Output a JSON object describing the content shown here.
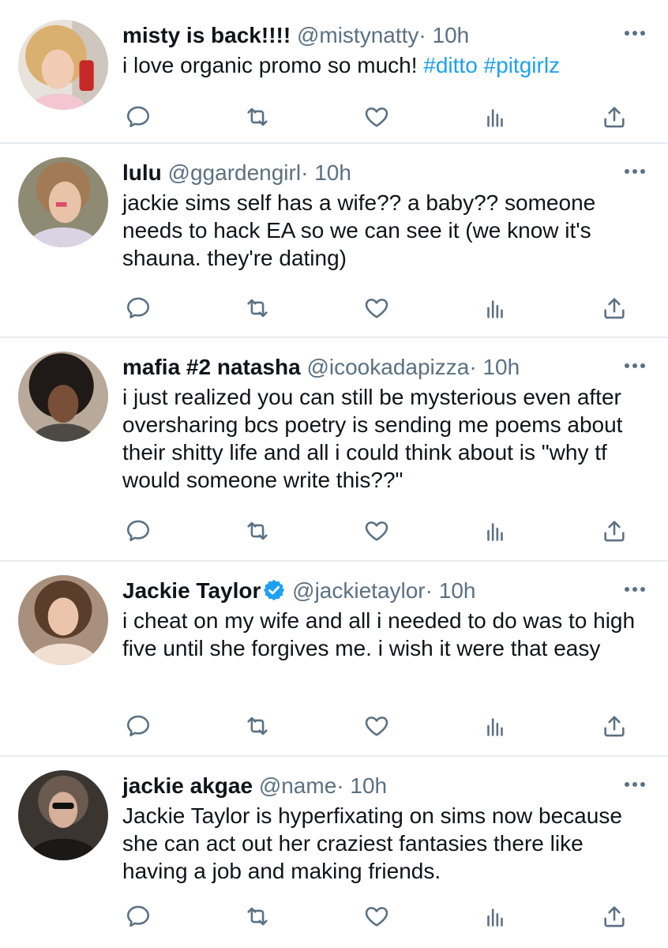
{
  "tweets": [
    {
      "name": "misty is back!!!!",
      "handle": "@mistynatty",
      "separator": "·",
      "time": "10h",
      "text": "i love organic promo so much! ",
      "hashtags": "#ditto #pitgirlz",
      "verified": false
    },
    {
      "name": "lulu",
      "handle": "@ggardengirl",
      "separator": "·",
      "time": "10h",
      "text": "jackie sims self has a wife?? a baby?? someone needs to hack EA so we can see it (we know it's shauna. they're dating)",
      "verified": false
    },
    {
      "name": "mafia #2 natasha",
      "handle": "@icookadapizza",
      "separator": "·",
      "time": "10h",
      "text": "i just realized you can still be mysterious even after oversharing bcs poetry is sending me poems about their shitty life and all i could think about is \"why tf would someone write this??\"",
      "verified": false
    },
    {
      "name": "Jackie Taylor",
      "handle": "@jackietaylor",
      "separator": "·",
      "time": "10h",
      "text": "i cheat on my wife and all i needed to do was to high five until she forgives me. i wish it were that easy",
      "verified": true
    },
    {
      "name": "jackie akgae",
      "handle": "@name",
      "separator": "·",
      "time": "10h",
      "text": "Jackie Taylor is hyperfixating on sims now because she can act out her craziest fantasies there like having a job and making friends.",
      "verified": false
    }
  ],
  "icons": {
    "reply": "reply-icon",
    "retweet": "retweet-icon",
    "like": "heart-icon",
    "analytics": "analytics-icon",
    "share": "share-icon",
    "more": "more-icon",
    "verified": "verified-badge-icon"
  },
  "colors": {
    "text": "#0f1419",
    "secondary": "#5b7083",
    "hashtag": "#1da1f2",
    "verified": "#1da1f2",
    "divider": "#e6ecf0"
  }
}
